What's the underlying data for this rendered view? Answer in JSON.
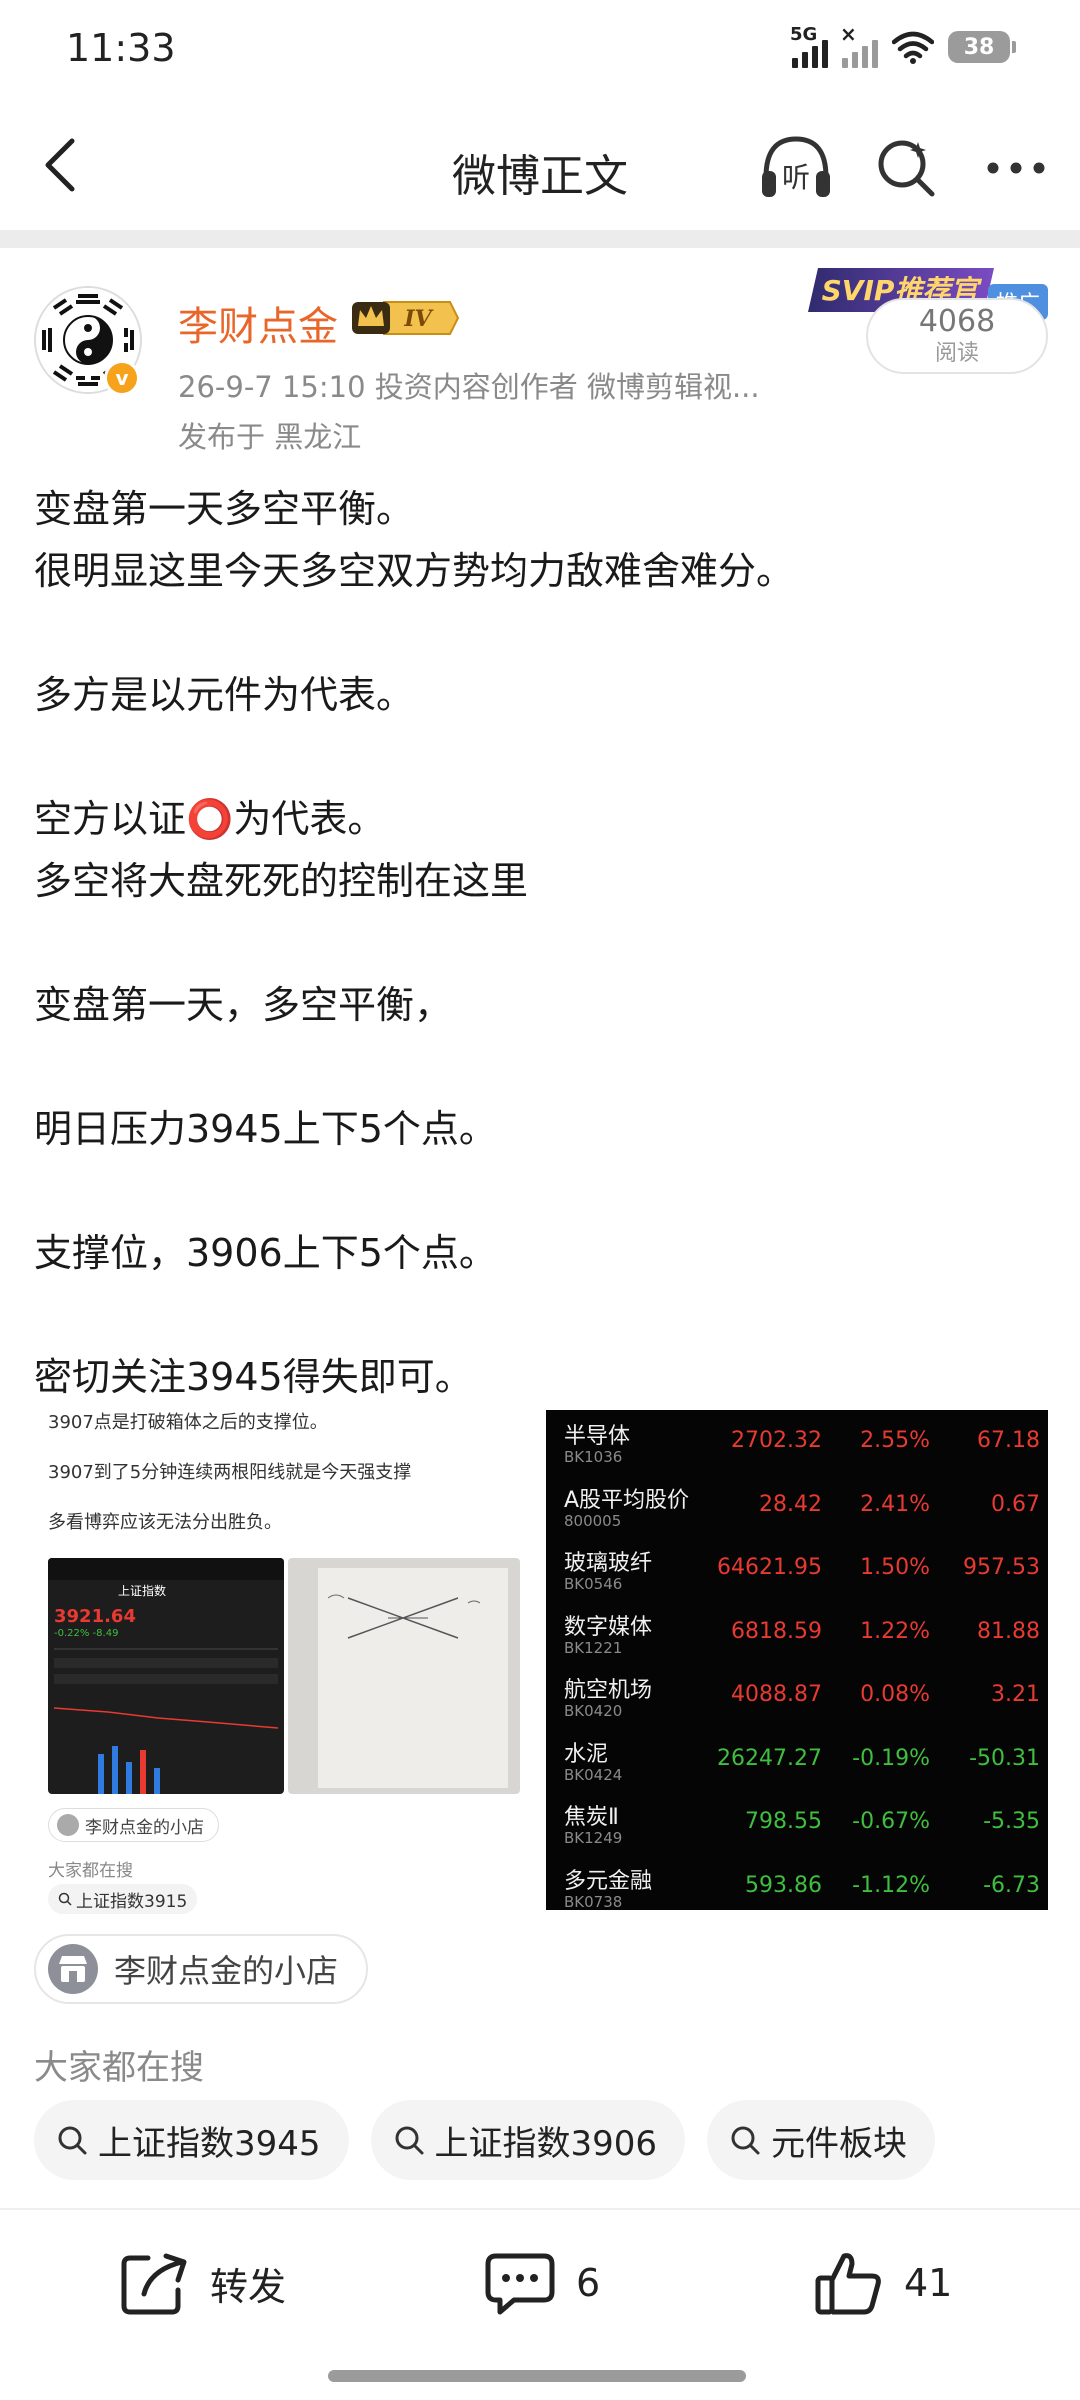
{
  "status_bar": {
    "time": "11:33",
    "network": "5G",
    "battery": "38"
  },
  "nav": {
    "title": "微博正文",
    "listen_label": "听"
  },
  "author": {
    "name": "李财点金",
    "level": "IV",
    "meta": "26-9-7 15:10  投资内容创作者 微博剪辑视...",
    "location": "发布于 黑龙江",
    "svip_tag": "SVIP推荐官",
    "promo_tag": "推广",
    "read_count": "4068",
    "read_label": "阅读"
  },
  "post": {
    "lines": [
      "变盘第一天多空平衡。",
      "很明显这里今天多空双方势均力敌难舍难分。",
      "",
      "多方是以元件为代表。",
      "",
      "空方以证⭕为代表。",
      "多空将大盘死死的控制在这里",
      "",
      "变盘第一天，多空平衡，",
      "",
      "明日压力3945上下5个点。",
      "",
      "支撑位，3906上下5个点。",
      "",
      "密切关注3945得失即可。"
    ]
  },
  "image_left": {
    "text1": "3907点是打破箱体之后的支撑位。",
    "text2": "3907到了5分钟连续两根阳线就是今天强支撑",
    "text3": "多看博弈应该无法分出胜负。",
    "phone_title": "上证指数",
    "phone_price": "3921.64",
    "phone_change": "-0.22%  -8.49",
    "shop": "李财点金的小店",
    "search_label": "大家都在搜",
    "search_item": "上证指数3915"
  },
  "sectors": [
    {
      "name": "半导体",
      "code": "BK1036",
      "price": "2702.32",
      "pct": "2.55%",
      "chg": "67.18",
      "dir": "up"
    },
    {
      "name": "A股平均股价",
      "code": "800005",
      "price": "28.42",
      "pct": "2.41%",
      "chg": "0.67",
      "dir": "up"
    },
    {
      "name": "玻璃玻纤",
      "code": "BK0546",
      "price": "64621.95",
      "pct": "1.50%",
      "chg": "957.53",
      "dir": "up"
    },
    {
      "name": "数字媒体",
      "code": "BK1221",
      "price": "6818.59",
      "pct": "1.22%",
      "chg": "81.88",
      "dir": "up"
    },
    {
      "name": "航空机场",
      "code": "BK0420",
      "price": "4088.87",
      "pct": "0.08%",
      "chg": "3.21",
      "dir": "up"
    },
    {
      "name": "水泥",
      "code": "BK0424",
      "price": "26247.27",
      "pct": "-0.19%",
      "chg": "-50.31",
      "dir": "down"
    },
    {
      "name": "焦炭Ⅱ",
      "code": "BK1249",
      "price": "798.55",
      "pct": "-0.67%",
      "chg": "-5.35",
      "dir": "down"
    },
    {
      "name": "多元金融",
      "code": "BK0738",
      "price": "593.86",
      "pct": "-1.12%",
      "chg": "-6.73",
      "dir": "down"
    }
  ],
  "shop": {
    "label": "李财点金的小店"
  },
  "search": {
    "title": "大家都在搜",
    "chips": [
      "上证指数3945",
      "上证指数3906",
      "元件板块"
    ]
  },
  "actions": {
    "repost": "转发",
    "comments": "6",
    "likes": "41"
  },
  "colors": {
    "author_name": "#e8662a",
    "up": "#e83a30",
    "down": "#3fbf3f",
    "promo": "#4e8fe0"
  }
}
